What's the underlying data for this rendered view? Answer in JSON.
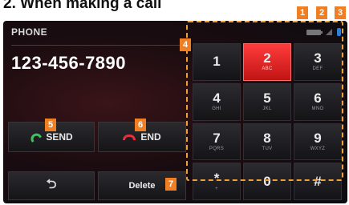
{
  "heading": "2. When making a call",
  "screen": {
    "title": "PHONE",
    "phone_number": "123-456-7890"
  },
  "buttons": {
    "send_label": "SEND",
    "end_label": "END",
    "back_symbol": "⮌",
    "delete_label": "Delete"
  },
  "keypad": [
    {
      "digit": "1",
      "letters": ""
    },
    {
      "digit": "2",
      "letters": "ABC"
    },
    {
      "digit": "3",
      "letters": "DEF"
    },
    {
      "digit": "4",
      "letters": "GHI"
    },
    {
      "digit": "5",
      "letters": "JKL"
    },
    {
      "digit": "6",
      "letters": "MNO"
    },
    {
      "digit": "7",
      "letters": "PQRS"
    },
    {
      "digit": "8",
      "letters": "TUV"
    },
    {
      "digit": "9",
      "letters": "WXYZ"
    },
    {
      "digit": "*",
      "letters": "+"
    },
    {
      "digit": "0",
      "letters": ""
    },
    {
      "digit": "#",
      "letters": ""
    }
  ],
  "markers": [
    "1",
    "2",
    "3",
    "4",
    "5",
    "6",
    "7"
  ],
  "colors": {
    "accent": "#f07e22",
    "active_key": "#e82020",
    "send_icon": "#3cc35a",
    "end_icon": "#e23040",
    "bluetooth": "#2f7fd8"
  },
  "icons": {
    "battery": "battery-icon",
    "signal": "signal-icon",
    "bluetooth": "bluetooth-icon"
  }
}
